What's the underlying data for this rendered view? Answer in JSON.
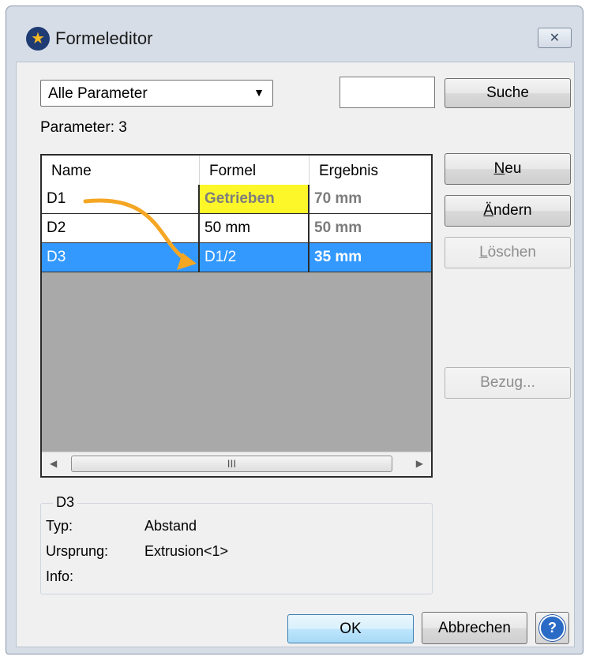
{
  "window": {
    "title": "Formeleditor",
    "close_glyph": "✕"
  },
  "filter": {
    "selected": "Alle Parameter",
    "arrow": "▼"
  },
  "search": {
    "value": "",
    "button_label": "Suche"
  },
  "parameter_count": "Parameter:  3",
  "table": {
    "columns": [
      "Name",
      "Formel",
      "Ergebnis"
    ],
    "rows": [
      {
        "name": "D1",
        "formula": "Getrieben",
        "result": "70 mm"
      },
      {
        "name": "D2",
        "formula": "50 mm",
        "result": "50 mm"
      },
      {
        "name": "D3",
        "formula": "D1/2",
        "result": "35 mm"
      }
    ],
    "selected_row": "D3",
    "scroll": {
      "left_arrow": "◀",
      "right_arrow": "▶",
      "grip": "III"
    }
  },
  "buttons": {
    "new": {
      "accel": "N",
      "rest": "eu"
    },
    "change": {
      "accel": "Ä",
      "rest": "ndern"
    },
    "delete": {
      "accel": "L",
      "rest": "öschen"
    },
    "reference": "Bezug...",
    "ok": "OK",
    "cancel": "Abbrechen",
    "help": "?"
  },
  "details": {
    "title": "D3",
    "fields": [
      {
        "label": "Typ:",
        "value": "Abstand"
      },
      {
        "label": "Ursprung:",
        "value": "Extrusion<1>"
      },
      {
        "label": "Info:",
        "value": ""
      }
    ]
  },
  "colors": {
    "selection": "#3399ff",
    "highlight": "#fdf72a",
    "annotation_arrow": "#f5a623"
  }
}
